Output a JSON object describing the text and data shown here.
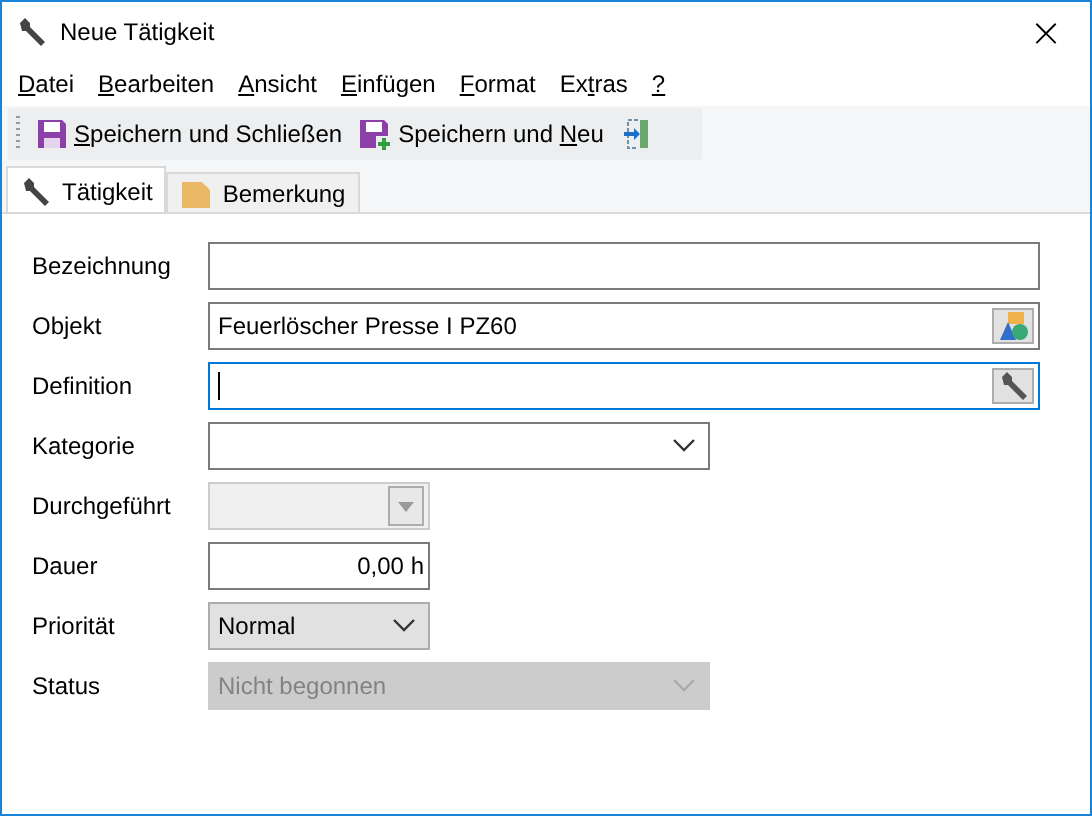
{
  "window": {
    "title": "Neue Tätigkeit",
    "close": "×"
  },
  "menu": [
    {
      "key": "D",
      "post": "atei"
    },
    {
      "key": "B",
      "post": "earbeiten"
    },
    {
      "key": "A",
      "post": "nsicht"
    },
    {
      "key": "E",
      "post": "infügen"
    },
    {
      "key": "F",
      "post": "ormat"
    },
    {
      "pre": "Ex",
      "key": "t",
      "post": "ras"
    },
    {
      "key": "?"
    }
  ],
  "toolbar": [
    {
      "kind": "save",
      "key": "S",
      "post": "peichern und Schließen"
    },
    {
      "kind": "savenew",
      "pre": "Speichern und ",
      "key": "N",
      "post": "eu"
    },
    {
      "kind": "exit"
    }
  ],
  "tabs": [
    {
      "kind": "wrench",
      "label": "Tätigkeit",
      "selected": true
    },
    {
      "kind": "note",
      "label": "Bemerkung",
      "selected": false
    }
  ],
  "fields": [
    {
      "label": "Bezeichnung",
      "kind": "text",
      "focused": false,
      "disabled": false
    },
    {
      "label": "Objekt",
      "kind": "objectref",
      "value": "Feuerlöscher Presse I PZ60",
      "focused": false,
      "disabled": false
    },
    {
      "label": "Definition",
      "kind": "toolref",
      "focused": true,
      "disabled": false
    },
    {
      "label": "Kategorie",
      "kind": "combo",
      "focused": false,
      "disabled": false
    },
    {
      "label": "Durchgeführt",
      "kind": "date",
      "focused": false,
      "disabled": true
    },
    {
      "label": "Dauer",
      "kind": "number",
      "value": "0,00 h",
      "focused": false,
      "disabled": false
    },
    {
      "label": "Priorität",
      "kind": "dropdown",
      "value": "Normal",
      "focused": false,
      "disabled": false
    },
    {
      "label": "Status",
      "kind": "combo",
      "value": "Nicht begonnen",
      "focused": false,
      "disabled": true
    }
  ]
}
